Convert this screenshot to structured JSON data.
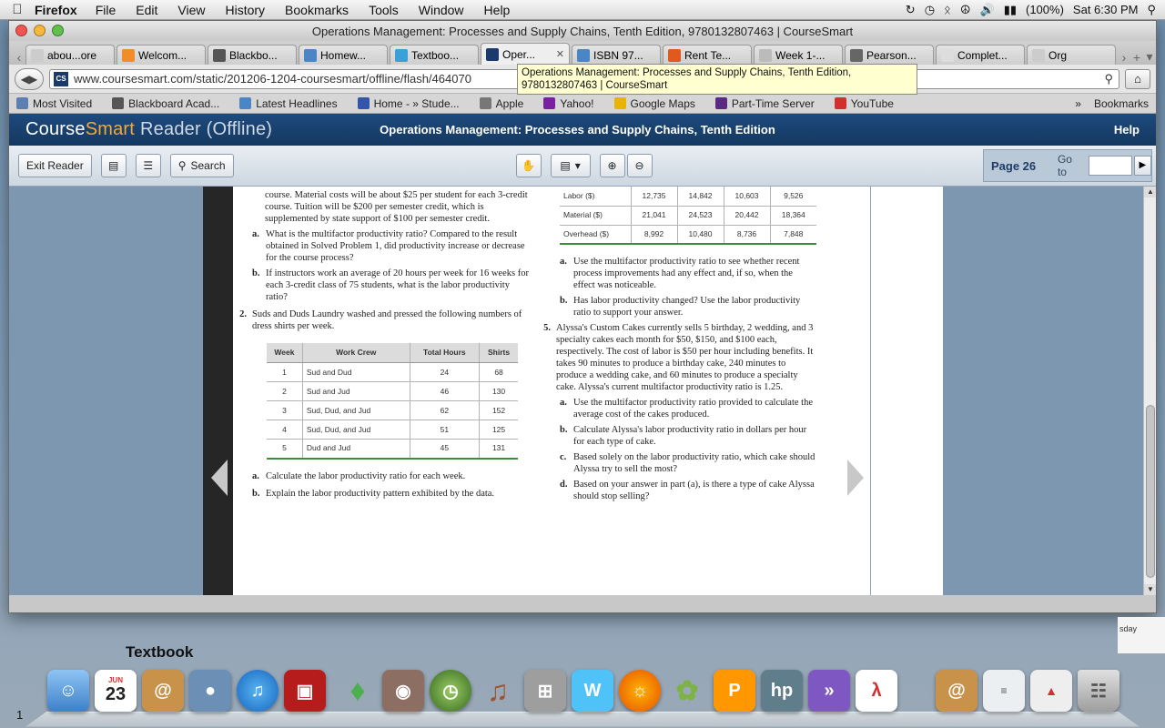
{
  "menubar": {
    "app": "Firefox",
    "items": [
      "File",
      "Edit",
      "View",
      "History",
      "Bookmarks",
      "Tools",
      "Window",
      "Help"
    ],
    "battery": "(100%)",
    "clock": "Sat 6:30 PM"
  },
  "window": {
    "title": "Operations Management: Processes and Supply Chains, Tenth Edition, 9780132807463 | CourseSmart"
  },
  "tabs": [
    {
      "label": "abou...ore",
      "color": "#cccccc"
    },
    {
      "label": "Welcom...",
      "color": "#f28c28"
    },
    {
      "label": "Blackbo...",
      "color": "#555555"
    },
    {
      "label": "Homew...",
      "color": "#4a86c5"
    },
    {
      "label": "Textboo...",
      "color": "#3aa0d8"
    },
    {
      "label": "Oper...",
      "color": "#1a3a6b"
    },
    {
      "label": "ISBN 97...",
      "color": "#4a86c5"
    },
    {
      "label": "Rent Te...",
      "color": "#e05a1e"
    },
    {
      "label": "Week 1-...",
      "color": "#bbbbbb"
    },
    {
      "label": "Pearson...",
      "color": "#666666"
    },
    {
      "label": "Complet...",
      "color": "#dddddd"
    },
    {
      "label": "Org",
      "color": "#cccccc"
    }
  ],
  "url": "www.coursesmart.com/static/201206-1204-coursesmart/offline/flash/464070",
  "tooltip": "Operations Management: Processes and Supply Chains, Tenth Edition, 9780132807463 | CourseSmart",
  "bookmarks": [
    {
      "label": "Most Visited",
      "color": "#5b7fb0"
    },
    {
      "label": "Blackboard Acad...",
      "color": "#555555"
    },
    {
      "label": "Latest Headlines",
      "color": "#4a86c5"
    },
    {
      "label": "Home - » Stude...",
      "color": "#3355aa"
    },
    {
      "label": "Apple",
      "color": "#777777"
    },
    {
      "label": "Yahoo!",
      "color": "#7b1fa2"
    },
    {
      "label": "Google Maps",
      "color": "#e8b400"
    },
    {
      "label": "Part-Time Server",
      "color": "#5a2a82"
    },
    {
      "label": "YouTube",
      "color": "#d32f2f"
    }
  ],
  "bookmarks_menu": "Bookmarks",
  "cs": {
    "brand_a": "Course",
    "brand_b": "Smart",
    "brand_c": "Reader (Offline)",
    "book_title": "Operations Management: Processes and Supply Chains, Tenth Edition",
    "help": "Help",
    "exit_reader": "Exit Reader",
    "search": "Search",
    "page": "Page 26",
    "goto": "Go to"
  },
  "book": {
    "left_intro": "course. Material costs will be about $25 per student for each 3-credit course. Tuition will be $200 per semester credit, which is supplemented by state support of $100 per semester credit.",
    "q1a": "What is the multifactor productivity ratio? Compared to the result obtained in Solved Problem 1, did productivity increase or decrease for the course process?",
    "q1b": "If instructors work an average of 20 hours per week for 16 weeks for each 3-credit class of 75 students, what is the labor productivity ratio?",
    "q2": "Suds and Duds Laundry washed and pressed the following numbers of dress shirts per week.",
    "q2_table": {
      "headers": [
        "Week",
        "Work Crew",
        "Total Hours",
        "Shirts"
      ],
      "rows": [
        [
          "1",
          "Sud and Dud",
          "24",
          "68"
        ],
        [
          "2",
          "Sud and Jud",
          "46",
          "130"
        ],
        [
          "3",
          "Sud, Dud, and Jud",
          "62",
          "152"
        ],
        [
          "4",
          "Sud, Dud, and Jud",
          "51",
          "125"
        ],
        [
          "5",
          "Dud and Jud",
          "45",
          "131"
        ]
      ]
    },
    "q2a": "Calculate the labor productivity ratio for each week.",
    "q2b": "Explain the labor productivity pattern exhibited by the data.",
    "cost_table": [
      [
        "Labor ($)",
        "12,735",
        "14,842",
        "10,603",
        "9,526"
      ],
      [
        "Material ($)",
        "21,041",
        "24,523",
        "20,442",
        "18,364"
      ],
      [
        "Overhead ($)",
        "8,992",
        "10,480",
        "8,736",
        "7,848"
      ]
    ],
    "q4a": "Use the multifactor productivity ratio to see whether recent process improvements had any effect and, if so, when the effect was noticeable.",
    "q4b": "Has labor productivity changed? Use the labor productivity ratio to support your answer.",
    "q5": "Alyssa's Custom Cakes currently sells 5 birthday, 2 wedding, and 3 specialty cakes each month for $50, $150, and $100 each, respectively. The cost of labor is $50 per hour including benefits. It takes 90 minutes to produce a birthday cake, 240 minutes to produce a wedding cake, and 60 minutes to produce a specialty cake. Alyssa's current multifactor productivity ratio is 1.25.",
    "q5a": "Use the multifactor productivity ratio provided to calculate the average cost of the cakes produced.",
    "q5b": "Calculate Alyssa's labor productivity ratio in dollars per hour for each type of cake.",
    "q5c": "Based solely on the labor productivity ratio, which cake should Alyssa try to sell the most?",
    "q5d": "Based on your answer in part (a), is there a type of cake Alyssa should stop selling?"
  },
  "desktop": {
    "label": "Textbook",
    "calendar_month": "JUN",
    "calendar_day": "23",
    "corner": "1",
    "right_edge": "sday"
  }
}
